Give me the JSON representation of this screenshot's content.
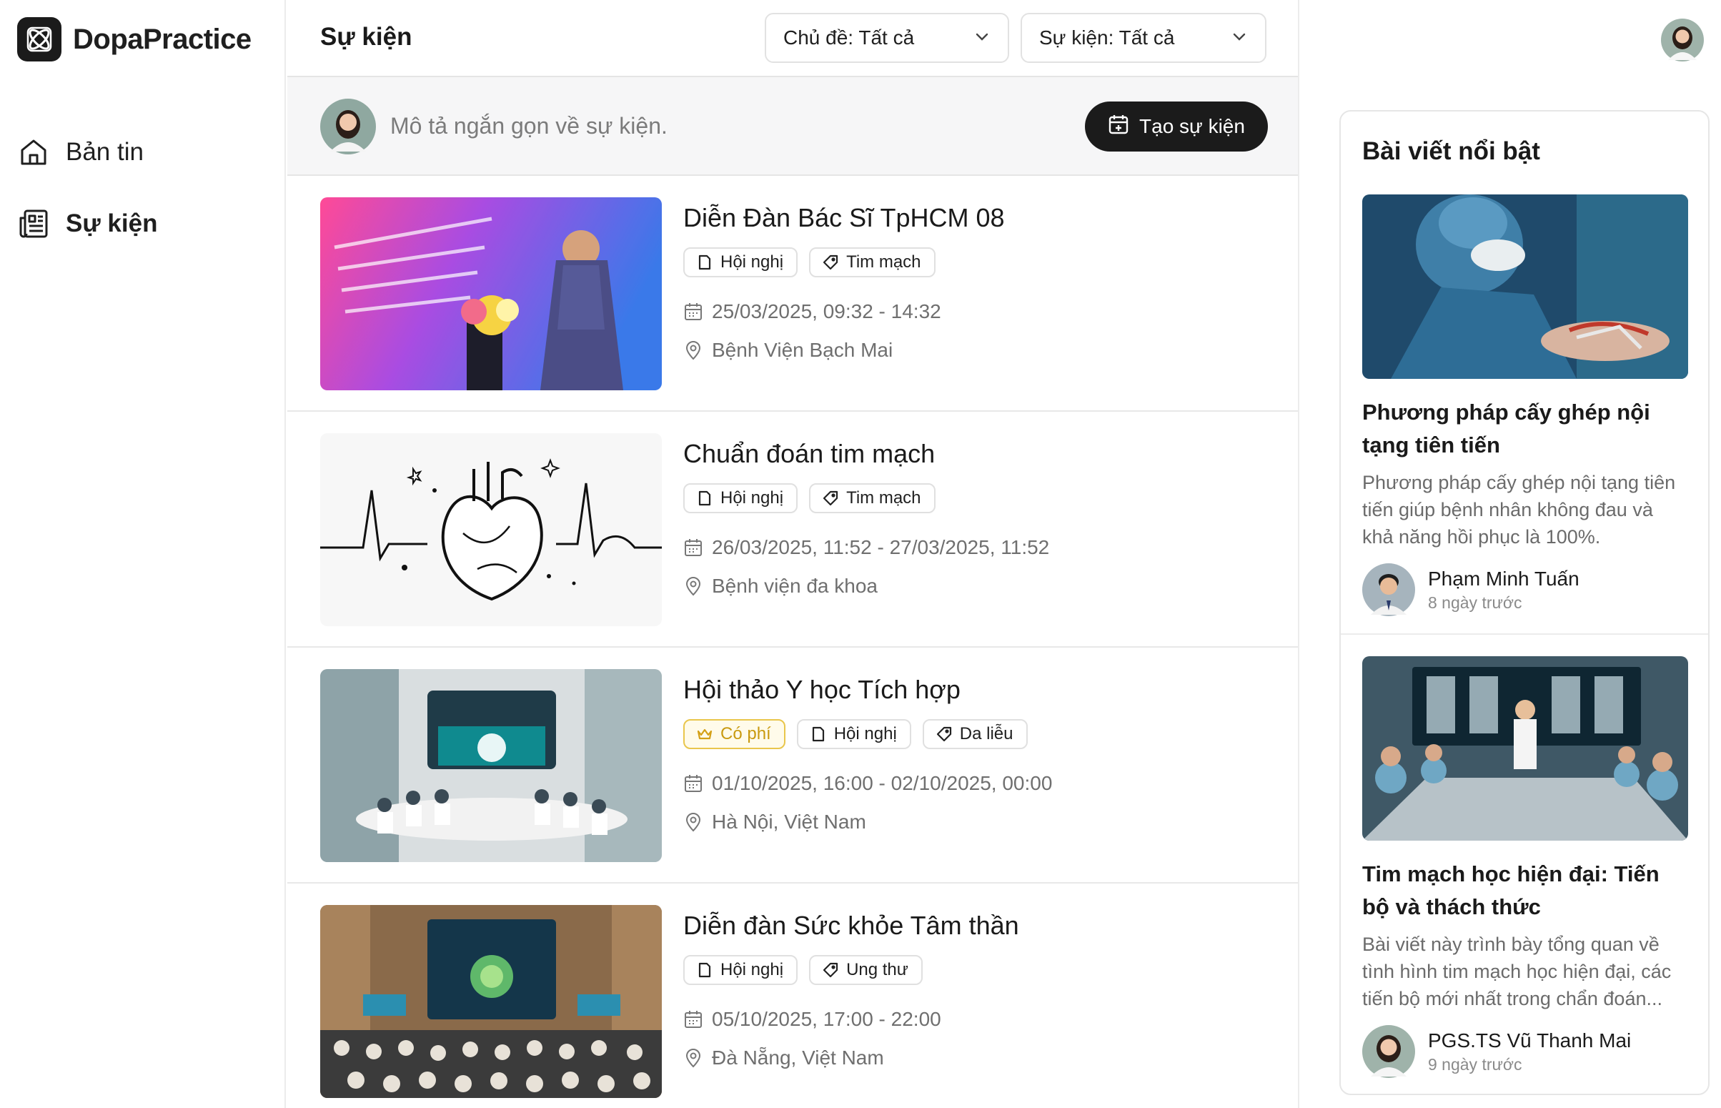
{
  "brand": {
    "name": "DopaPractice",
    "logo_icon": "atom-icon"
  },
  "sidebar": {
    "items": [
      {
        "label": "Bản tin",
        "icon": "home-icon",
        "active": false
      },
      {
        "label": "Sự kiện",
        "icon": "newspaper-icon",
        "active": true
      }
    ]
  },
  "header": {
    "title": "Sự kiện",
    "filters": [
      {
        "label": "Chủ đề: Tất cả"
      },
      {
        "label": "Sự kiện: Tất cả"
      }
    ]
  },
  "composer": {
    "placeholder": "Mô tả ngắn gọn về sự kiện.",
    "button_label": "Tạo sự kiện"
  },
  "events": [
    {
      "title": "Diễn Đàn Bác Sĩ TpHCM 08",
      "tags": [
        "Hội nghị",
        "Tim mạch"
      ],
      "date": "25/03/2025, 09:32 - 14:32",
      "location": "Bệnh Viện Bạch Mai"
    },
    {
      "title": "Chuẩn đoán tim mạch",
      "tags": [
        "Hội nghị",
        "Tim mạch"
      ],
      "date": "26/03/2025, 11:52 - 27/03/2025, 11:52",
      "location": "Bệnh viện đa khoa"
    },
    {
      "title": "Hội thảo Y học Tích hợp",
      "paid_label": "Có phí",
      "tags": [
        "Hội nghị",
        "Da liễu"
      ],
      "date": "01/10/2025, 16:00 - 02/10/2025, 00:00",
      "location": "Hà Nội, Việt Nam"
    },
    {
      "title": "Diễn đàn Sức khỏe Tâm thần",
      "tags": [
        "Hội nghị",
        "Ung thư"
      ],
      "date": "05/10/2025, 17:00 - 22:00",
      "location": "Đà Nẵng, Việt Nam"
    }
  ],
  "featured": {
    "title": "Bài viết nổi bật",
    "articles": [
      {
        "title": "Phương pháp cấy ghép nội tạng tiên tiến",
        "excerpt": "Phương pháp cấy ghép nội tạng tiên tiến giúp bệnh nhân không đau và khả năng hồi phục là 100%.",
        "author": "Phạm Minh Tuấn",
        "time": "8 ngày trước"
      },
      {
        "title": "Tim mạch học hiện đại: Tiến bộ và thách thức",
        "excerpt": "Bài viết này trình bày tổng quan về tình hình tim mạch học hiện đại, các tiến bộ mới nhất trong chẩn đoán...",
        "author": "PGS.TS Vũ Thanh Mai",
        "time": "9 ngày trước"
      }
    ]
  }
}
